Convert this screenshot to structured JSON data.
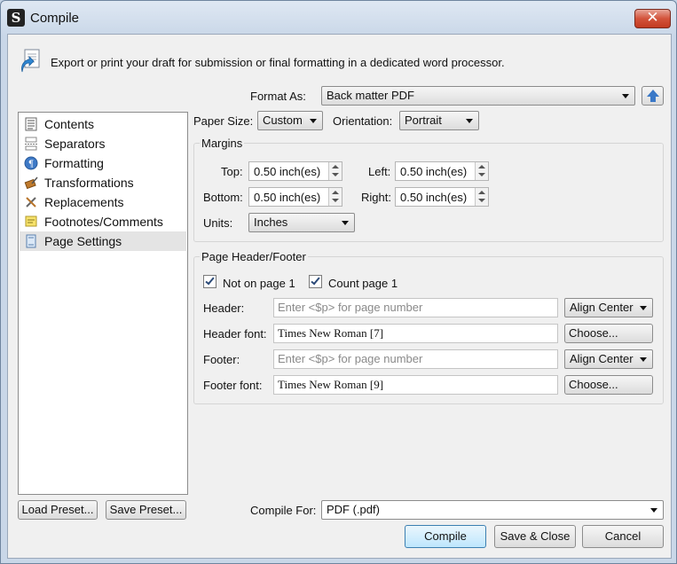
{
  "window": {
    "title": "Compile",
    "app_icon": "scrivener-icon",
    "close": "✕"
  },
  "header": {
    "text": "Export or print your draft for submission or final formatting in a dedicated word processor."
  },
  "format_as": {
    "label": "Format As:",
    "value": "Back matter PDF"
  },
  "sidebar": {
    "items": [
      {
        "label": "Contents",
        "icon": "contents-icon"
      },
      {
        "label": "Separators",
        "icon": "separators-icon"
      },
      {
        "label": "Formatting",
        "icon": "formatting-icon"
      },
      {
        "label": "Transformations",
        "icon": "transformations-icon"
      },
      {
        "label": "Replacements",
        "icon": "replacements-icon"
      },
      {
        "label": "Footnotes/Comments",
        "icon": "footnotes-icon"
      },
      {
        "label": "Page Settings",
        "icon": "page-settings-icon",
        "selected": true
      }
    ]
  },
  "paper": {
    "size_label": "Paper Size:",
    "size_value": "Custom",
    "orientation_label": "Orientation:",
    "orientation_value": "Portrait"
  },
  "margins": {
    "title": "Margins",
    "top_label": "Top:",
    "top_value": "0.50 inch(es)",
    "left_label": "Left:",
    "left_value": "0.50 inch(es)",
    "bottom_label": "Bottom:",
    "bottom_value": "0.50 inch(es)",
    "right_label": "Right:",
    "right_value": "0.50 inch(es)",
    "units_label": "Units:",
    "units_value": "Inches"
  },
  "header_footer": {
    "title": "Page Header/Footer",
    "not_on_page1": {
      "label": "Not on page 1",
      "checked": true
    },
    "count_page1": {
      "label": "Count page 1",
      "checked": true
    },
    "header_label": "Header:",
    "header_placeholder": "Enter <$p> for page number",
    "header_align": "Align Center",
    "header_font_label": "Header font:",
    "header_font": "Times New Roman [7]",
    "footer_label": "Footer:",
    "footer_placeholder": "Enter <$p> for page number",
    "footer_align": "Align Center",
    "footer_font_label": "Footer font:",
    "footer_font": "Times New Roman [9]",
    "choose_label": "Choose..."
  },
  "presets": {
    "load": "Load Preset...",
    "save": "Save Preset..."
  },
  "compile_for": {
    "label": "Compile For:",
    "value": "PDF (.pdf)"
  },
  "actions": {
    "compile": "Compile",
    "save_close": "Save & Close",
    "cancel": "Cancel"
  },
  "colors": {
    "accent": "#3a78c7",
    "close_red": "#c23a20",
    "selection": "#e4e4e4"
  }
}
